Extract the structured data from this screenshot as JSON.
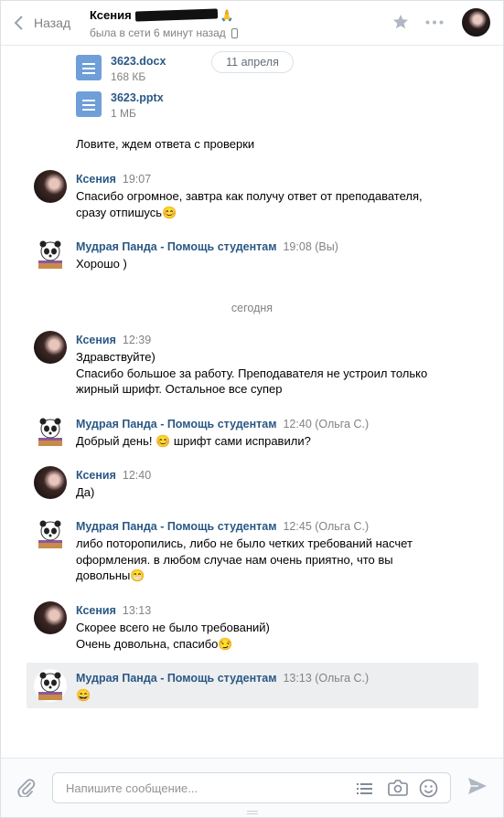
{
  "header": {
    "back_label": "Назад",
    "peer_name": "Ксения",
    "peer_status": "была в сети 6 минут назад"
  },
  "files": [
    {
      "name": "3623.docx",
      "size": "168 КБ"
    },
    {
      "name": "3623.pptx",
      "size": "1 МБ"
    }
  ],
  "date_pill": "11 апреля",
  "messages": [
    {
      "text": "Ловите, ждем ответа с проверки"
    },
    {
      "author": "Ксения",
      "time": "19:07",
      "lines": [
        "Спасибо огромное, завтра как получу ответ от преподавателя,",
        "сразу отпишусь😊"
      ]
    },
    {
      "author": "Мудрая Панда - Помощь студентам",
      "time": "19:08 (Вы)",
      "lines": [
        "Хорошо )"
      ]
    },
    {
      "author": "Ксения",
      "time": "12:39",
      "lines": [
        "Здравствуйте)",
        "Спасибо большое за работу. Преподавателя не устроил только",
        "жирный шрифт. Остальное все супер"
      ]
    },
    {
      "author": "Мудрая Панда - Помощь студентам",
      "time": "12:40 (Ольга С.)",
      "lines": [
        "Добрый день! 😊 шрифт сами исправили?"
      ]
    },
    {
      "author": "Ксения",
      "time": "12:40",
      "lines": [
        "Да)"
      ]
    },
    {
      "author": "Мудрая Панда - Помощь студентам",
      "time": "12:45 (Ольга С.)",
      "lines": [
        "либо поторопились, либо не было четких требований насчет",
        "оформления. в любом случае нам очень приятно, что вы",
        "довольны😁"
      ]
    },
    {
      "author": "Ксения",
      "time": "13:13",
      "lines": [
        "Скорее всего не было требований)",
        "Очень довольна, спасибо😏"
      ]
    },
    {
      "author": "Мудрая Панда - Помощь студентам",
      "time": "13:13 (Ольга С.)",
      "lines": [
        "😄"
      ]
    }
  ],
  "day_separator": "сегодня",
  "composer": {
    "placeholder": "Напишите сообщение..."
  },
  "icons": [
    "chevron-left-icon",
    "star-icon",
    "more-icon",
    "paperclip-icon",
    "list-icon",
    "camera-icon",
    "smile-icon",
    "send-icon"
  ],
  "colors": {
    "link": "#2a5885",
    "muted": "#828282",
    "file_icon": "#6f9fd8",
    "selected_bg": "#edeef0"
  }
}
